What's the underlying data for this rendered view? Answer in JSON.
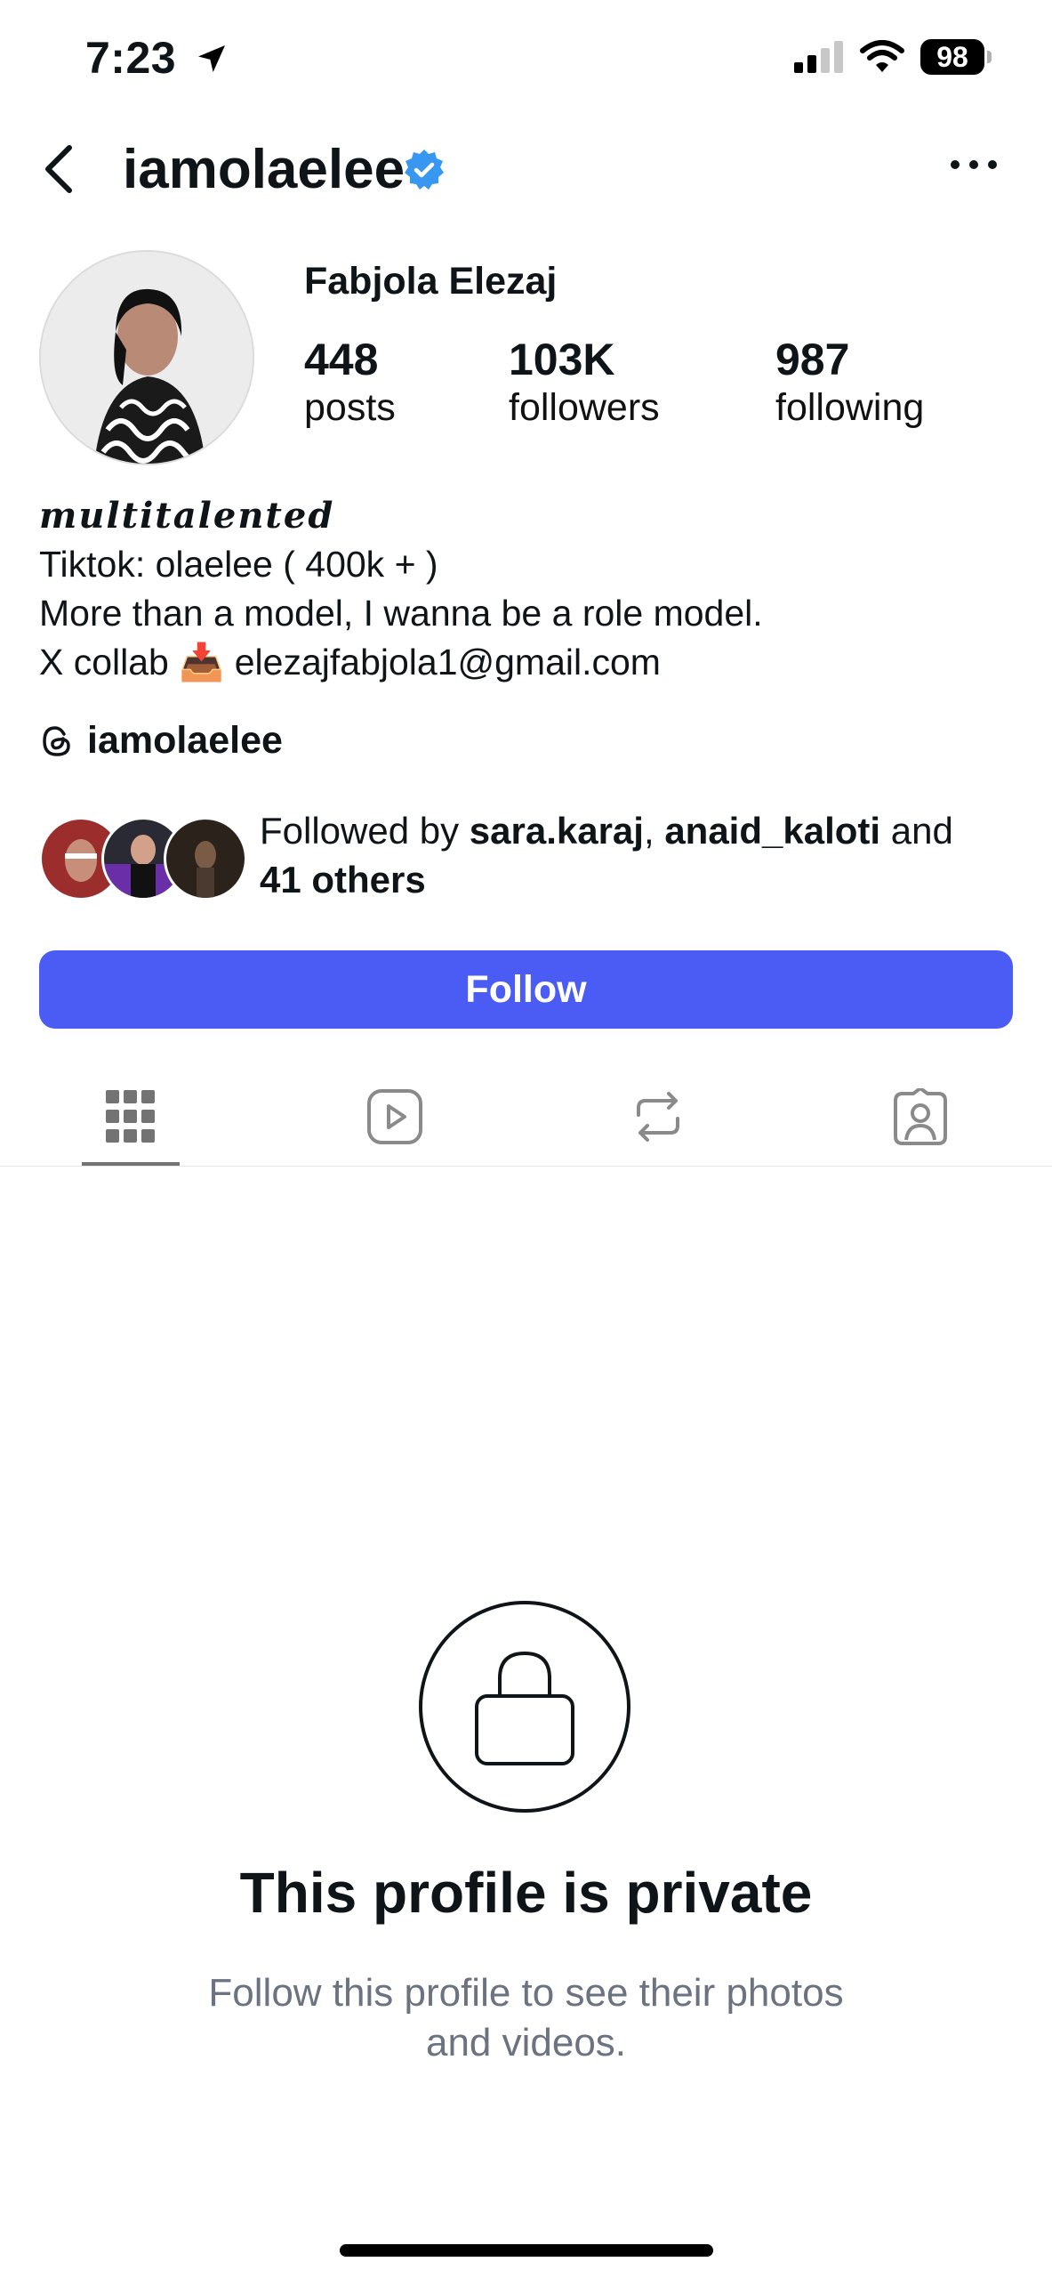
{
  "status": {
    "time": "7:23",
    "battery": "98"
  },
  "header": {
    "username": "iamolaelee"
  },
  "profile": {
    "full_name": "Fabjola Elezaj",
    "stats": [
      {
        "value": "448",
        "label": "posts"
      },
      {
        "value": "103K",
        "label": "followers"
      },
      {
        "value": "987",
        "label": "following"
      }
    ],
    "bio": {
      "tagline": "multitalented",
      "line1": "Tiktok: olaelee ( 400k + )",
      "line2": "More than a model, I wanna be a role model.",
      "line3_prefix": "X collab",
      "line3_emoji": "📥",
      "line3_email": "elezajfabjola1@gmail.com"
    },
    "threads_handle": "iamolaelee"
  },
  "followed_by": {
    "prefix": "Followed by ",
    "user1": "sara.karaj",
    "sep": ", ",
    "user2": "anaid_kaloti",
    "and": " and",
    "others": "41 others"
  },
  "actions": {
    "follow_label": "Follow"
  },
  "tabs": [
    "grid-icon",
    "reels-icon",
    "reposts-icon",
    "tagged-icon"
  ],
  "private": {
    "title": "This profile is private",
    "subtitle_line1": "Follow this profile to see their photos",
    "subtitle_line2": "and videos."
  },
  "colors": {
    "accent": "#4a5cf3",
    "verified": "#3897f0",
    "muted": "#6b7280"
  }
}
